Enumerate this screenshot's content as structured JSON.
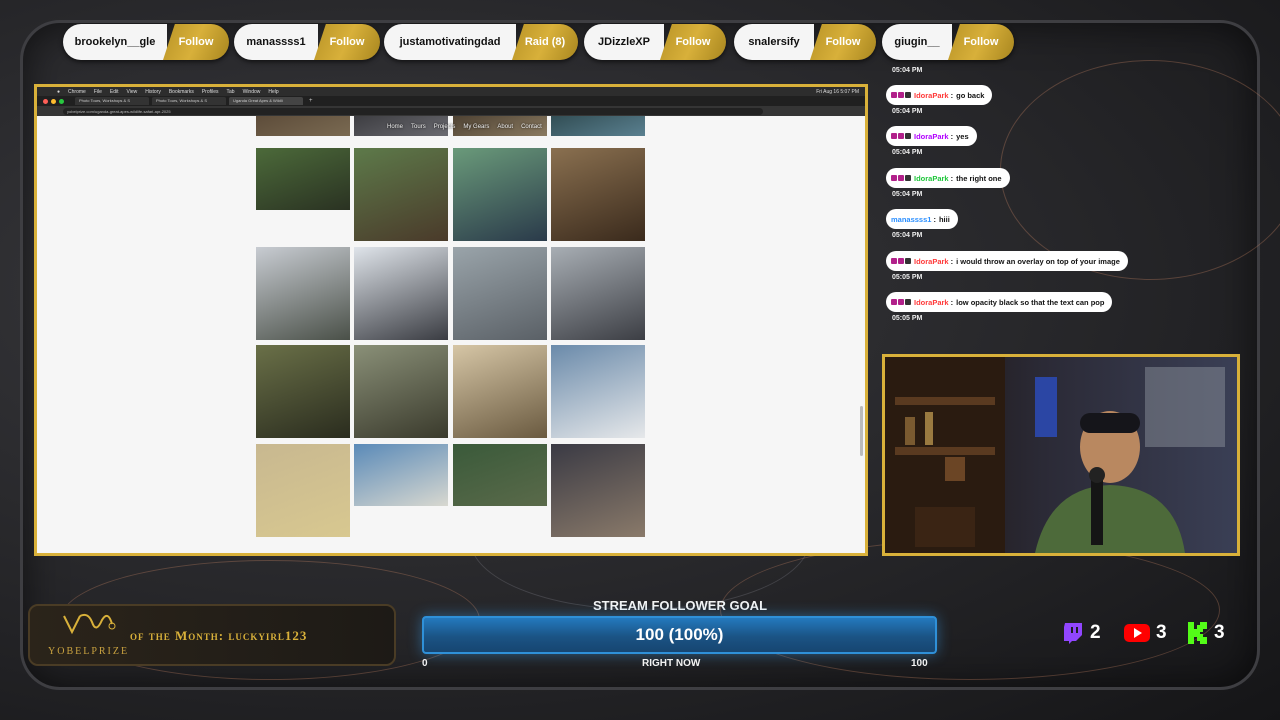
{
  "followers_bar": [
    {
      "name": "brookelyn__gle",
      "action": "Follow"
    },
    {
      "name": "manassss1",
      "action": "Follow"
    },
    {
      "name": "justamotivatingdad",
      "action": "Raid (8)"
    },
    {
      "name": "JDizzleXP",
      "action": "Follow"
    },
    {
      "name": "snalersify",
      "action": "Follow"
    },
    {
      "name": "giugin__",
      "action": "Follow"
    }
  ],
  "browser": {
    "menu": [
      "Chrome",
      "File",
      "Edit",
      "View",
      "History",
      "Bookmarks",
      "Profiles",
      "Tab",
      "Window",
      "Help"
    ],
    "clock": "Fri Aug 16  5:07 PM",
    "tabs": [
      "Photo Tours, Workshops & S",
      "Photo Tours, Workshops & S",
      "Uganda Great Apes & Wildli"
    ],
    "url": "yobelprize.com/uganda-great-apes-wildlife-safari-apr-2025",
    "site_nav": [
      "Home",
      "Tours",
      "Projects",
      "My Gears",
      "About",
      "Contact"
    ]
  },
  "chat": {
    "messages": [
      {
        "time_above": "05:04 PM",
        "user": "IdoraPark",
        "user_color": "#ff3a3a",
        "text": "go back"
      },
      {
        "time_above": "05:04 PM",
        "user": "IdoraPark",
        "user_color": "#b100ff",
        "text": "yes"
      },
      {
        "time_above": "05:04 PM",
        "user": "IdoraPark",
        "user_color": "#1ec63a",
        "text": "the right one"
      },
      {
        "time_above": "05:04 PM",
        "user": "manassss1",
        "user_color": "#2b8fff",
        "text": "hiii"
      },
      {
        "time_above": "05:04 PM",
        "user": "IdoraPark",
        "user_color": "#ff3a3a",
        "text": "i would throw an overlay on top of your image"
      },
      {
        "time_above": "05:05 PM",
        "user": "IdoraPark",
        "user_color": "#ff3a3a",
        "text": "low opacity black so that the text can pop"
      }
    ],
    "last_time": "05:05 PM"
  },
  "sub_of_month": {
    "text": "of the Month: luckyirl123",
    "logo_text": "YOBELPRIZE"
  },
  "goal": {
    "title": "STREAM FOLLOWER GOAL",
    "value_text": "100 (100%)",
    "progress": 1.0,
    "min_label": "0",
    "max_label": "100",
    "time_label": "RIGHT NOW"
  },
  "platforms": [
    {
      "icon": "twitch-icon",
      "count": "2",
      "color": "#9146ff"
    },
    {
      "icon": "youtube-icon",
      "count": "3",
      "color": "#ff0000"
    },
    {
      "icon": "kick-icon",
      "count": "3",
      "color": "#53fc18"
    }
  ],
  "colors": {
    "gold": "#d9b13a",
    "goal_blue": "#2f90d8"
  }
}
